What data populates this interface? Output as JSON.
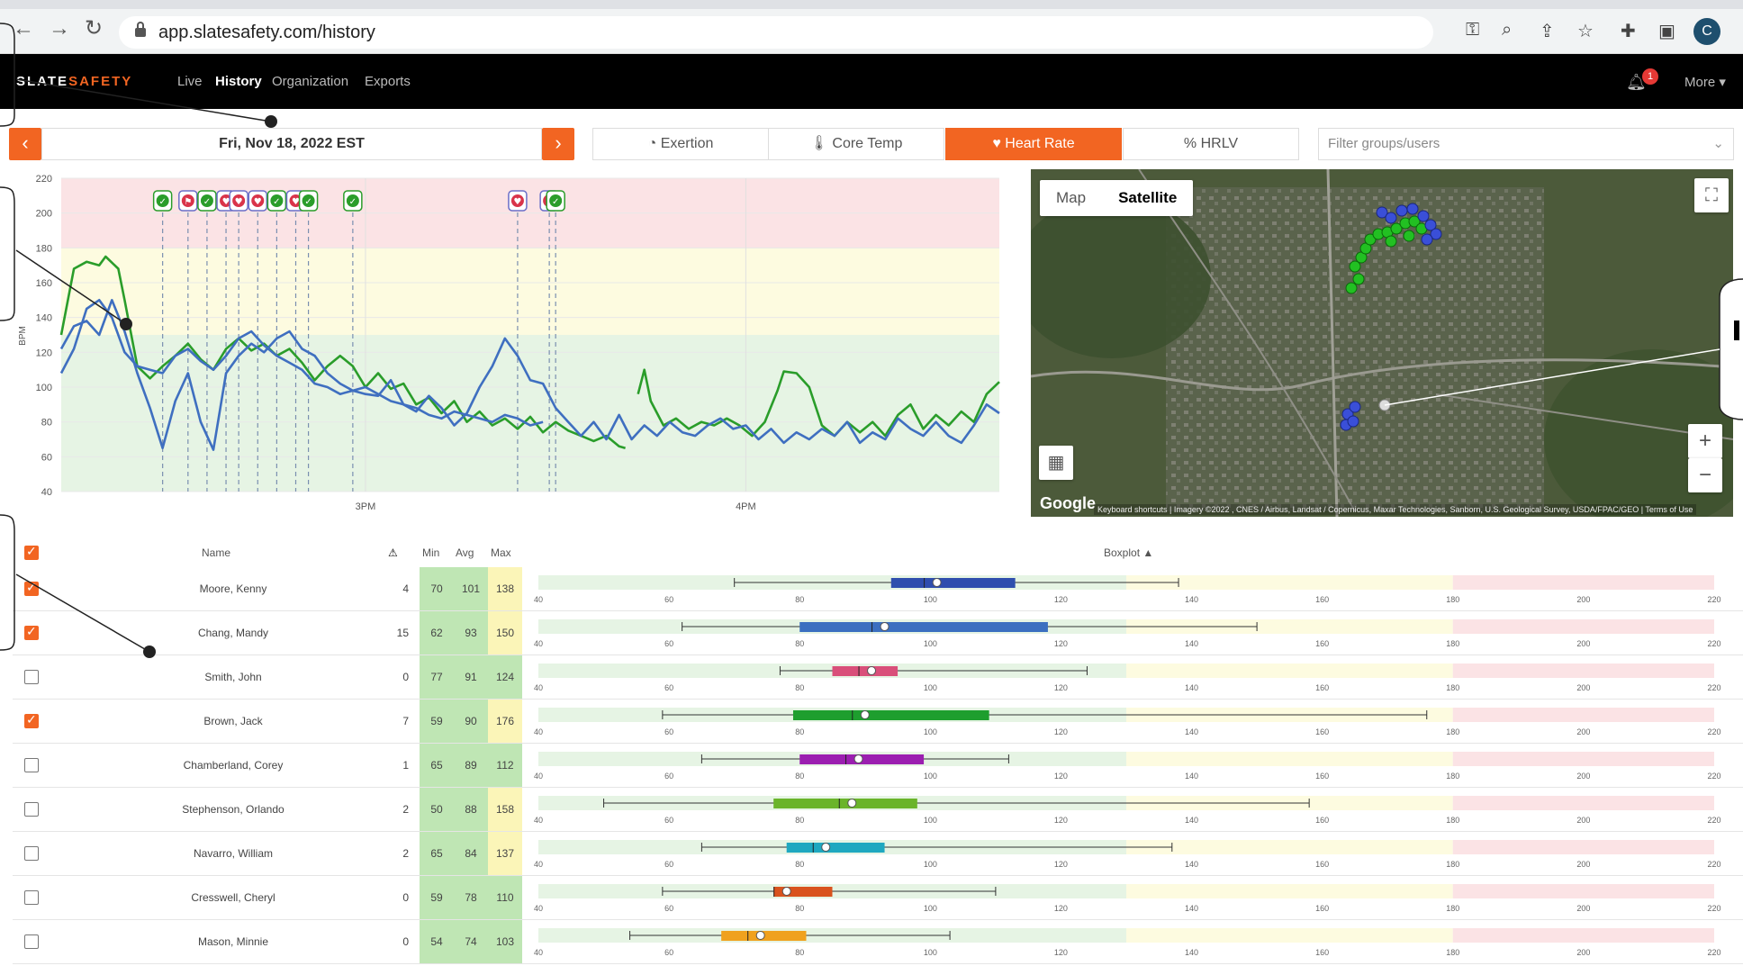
{
  "browser": {
    "url": "app.slatesafety.com/history",
    "profile_initial": "C"
  },
  "nav": {
    "logo_a": "SLATE",
    "logo_b": "SAFETY",
    "links": [
      "Live",
      "History",
      "Organization",
      "Exports"
    ],
    "notification_count": "1",
    "more_label": "More ▾"
  },
  "date_bar": {
    "date": "Fri, Nov 18, 2022 EST",
    "prev_symbol": "‹",
    "next_symbol": "›"
  },
  "metric_tabs": [
    {
      "icon": "gauge-icon",
      "label": "Exertion",
      "active": false
    },
    {
      "icon": "thermometer-icon",
      "label": "Core Temp",
      "active": false
    },
    {
      "icon": "heart-icon",
      "label": "Heart Rate",
      "active": true
    },
    {
      "icon": "percent-icon",
      "label": "HRLV",
      "active": false
    }
  ],
  "filter": {
    "placeholder": "Filter groups/users"
  },
  "map": {
    "tabs": [
      "Map",
      "Satellite"
    ],
    "selected_tab": "Satellite",
    "google": "Google",
    "attribution": "Keyboard shortcuts  |  Imagery ©2022 , CNES / Airbus, Landsat / Copernicus, Maxar Technologies, Sanborn, U.S. Geological Survey, USDA/FPAC/GEO  |  Terms of Use"
  },
  "chart_data": {
    "type": "line",
    "ylabel": "BPM",
    "ylim": [
      40,
      220
    ],
    "yticks": [
      40,
      60,
      80,
      100,
      120,
      140,
      160,
      180,
      200,
      220
    ],
    "xticks": [
      {
        "label": "3PM",
        "x": 900
      },
      {
        "label": "4PM",
        "x": 960
      }
    ],
    "xlim": [
      852,
      1000
    ],
    "zones": [
      {
        "from": 40,
        "to": 130,
        "color": "#e6f4e4"
      },
      {
        "from": 130,
        "to": 180,
        "color": "#fdfbe0"
      },
      {
        "from": 180,
        "to": 220,
        "color": "#fbe3e5"
      }
    ],
    "events": [
      {
        "x": 868,
        "type": "check"
      },
      {
        "x": 872,
        "type": "flag"
      },
      {
        "x": 875,
        "type": "check"
      },
      {
        "x": 878,
        "type": "heart"
      },
      {
        "x": 880,
        "type": "heart"
      },
      {
        "x": 883,
        "type": "heart"
      },
      {
        "x": 886,
        "type": "check"
      },
      {
        "x": 889,
        "type": "heart"
      },
      {
        "x": 891,
        "type": "check"
      },
      {
        "x": 898,
        "type": "check"
      },
      {
        "x": 924,
        "type": "heart"
      },
      {
        "x": 929,
        "type": "heart"
      },
      {
        "x": 930,
        "type": "check"
      }
    ],
    "series": [
      {
        "color": "#2a9d2a",
        "points": [
          [
            852,
            130
          ],
          [
            854,
            168
          ],
          [
            856,
            172
          ],
          [
            858,
            170
          ],
          [
            859,
            175
          ],
          [
            861,
            168
          ],
          [
            862,
            150
          ],
          [
            864,
            112
          ],
          [
            866,
            105
          ],
          [
            868,
            112
          ],
          [
            870,
            118
          ],
          [
            872,
            125
          ],
          [
            874,
            116
          ],
          [
            876,
            110
          ],
          [
            878,
            122
          ],
          [
            880,
            128
          ],
          [
            882,
            121
          ],
          [
            884,
            125
          ],
          [
            886,
            118
          ],
          [
            888,
            122
          ],
          [
            890,
            114
          ],
          [
            892,
            104
          ],
          [
            894,
            112
          ],
          [
            896,
            118
          ],
          [
            898,
            112
          ],
          [
            900,
            100
          ],
          [
            902,
            108
          ],
          [
            904,
            99
          ],
          [
            906,
            102
          ],
          [
            908,
            90
          ],
          [
            910,
            94
          ],
          [
            912,
            85
          ],
          [
            914,
            92
          ],
          [
            916,
            80
          ],
          [
            918,
            86
          ],
          [
            920,
            78
          ],
          [
            922,
            82
          ],
          [
            924,
            76
          ],
          [
            926,
            83
          ],
          [
            928,
            74
          ],
          [
            930,
            80
          ],
          [
            932,
            75
          ],
          [
            934,
            72
          ],
          [
            936,
            69
          ],
          [
            938,
            72
          ],
          [
            940,
            66
          ],
          [
            941,
            65
          ]
        ]
      },
      {
        "color": "#2a9d2a",
        "points": [
          [
            943,
            96
          ],
          [
            944,
            110
          ],
          [
            945,
            92
          ],
          [
            947,
            78
          ],
          [
            949,
            82
          ],
          [
            951,
            76
          ],
          [
            953,
            80
          ],
          [
            955,
            78
          ],
          [
            957,
            82
          ],
          [
            959,
            78
          ],
          [
            961,
            72
          ],
          [
            963,
            80
          ],
          [
            965,
            98
          ],
          [
            966,
            109
          ],
          [
            968,
            108
          ],
          [
            970,
            100
          ],
          [
            972,
            78
          ],
          [
            974,
            72
          ],
          [
            976,
            80
          ],
          [
            978,
            74
          ],
          [
            980,
            80
          ],
          [
            982,
            72
          ],
          [
            984,
            84
          ],
          [
            986,
            90
          ],
          [
            988,
            76
          ],
          [
            990,
            84
          ],
          [
            992,
            78
          ],
          [
            994,
            86
          ],
          [
            996,
            80
          ],
          [
            998,
            96
          ],
          [
            1000,
            103
          ]
        ]
      },
      {
        "color": "#3f6fc0",
        "points": [
          [
            852,
            122
          ],
          [
            854,
            135
          ],
          [
            856,
            138
          ],
          [
            858,
            130
          ],
          [
            860,
            150
          ],
          [
            862,
            132
          ],
          [
            864,
            108
          ],
          [
            866,
            88
          ],
          [
            868,
            65
          ],
          [
            870,
            92
          ],
          [
            872,
            108
          ],
          [
            874,
            80
          ],
          [
            876,
            64
          ],
          [
            878,
            108
          ],
          [
            880,
            118
          ],
          [
            882,
            125
          ],
          [
            884,
            120
          ],
          [
            886,
            128
          ],
          [
            888,
            132
          ],
          [
            890,
            122
          ],
          [
            892,
            118
          ],
          [
            894,
            108
          ],
          [
            896,
            102
          ],
          [
            898,
            98
          ],
          [
            900,
            96
          ],
          [
            902,
            95
          ],
          [
            904,
            104
          ],
          [
            906,
            90
          ],
          [
            908,
            86
          ],
          [
            910,
            95
          ],
          [
            912,
            88
          ],
          [
            914,
            78
          ],
          [
            916,
            85
          ],
          [
            918,
            100
          ],
          [
            920,
            112
          ],
          [
            922,
            128
          ],
          [
            924,
            118
          ],
          [
            926,
            104
          ],
          [
            928,
            102
          ],
          [
            930,
            88
          ],
          [
            932,
            80
          ],
          [
            934,
            72
          ],
          [
            936,
            80
          ],
          [
            938,
            70
          ],
          [
            940,
            84
          ],
          [
            942,
            70
          ],
          [
            944,
            78
          ],
          [
            946,
            72
          ],
          [
            948,
            80
          ],
          [
            950,
            74
          ],
          [
            952,
            72
          ],
          [
            954,
            78
          ],
          [
            956,
            82
          ],
          [
            958,
            76
          ],
          [
            960,
            78
          ],
          [
            962,
            70
          ],
          [
            964,
            76
          ],
          [
            966,
            68
          ],
          [
            968,
            74
          ],
          [
            970,
            70
          ],
          [
            972,
            76
          ],
          [
            974,
            72
          ],
          [
            976,
            80
          ],
          [
            978,
            68
          ],
          [
            980,
            74
          ],
          [
            982,
            70
          ],
          [
            984,
            82
          ],
          [
            986,
            76
          ],
          [
            988,
            72
          ],
          [
            990,
            80
          ],
          [
            992,
            72
          ],
          [
            994,
            68
          ],
          [
            996,
            78
          ],
          [
            998,
            90
          ],
          [
            1000,
            85
          ]
        ]
      },
      {
        "color": "#3f6fc0",
        "points": [
          [
            852,
            108
          ],
          [
            854,
            122
          ],
          [
            856,
            145
          ],
          [
            858,
            150
          ],
          [
            860,
            140
          ],
          [
            862,
            120
          ],
          [
            864,
            112
          ],
          [
            866,
            110
          ],
          [
            868,
            108
          ],
          [
            870,
            118
          ],
          [
            872,
            122
          ],
          [
            874,
            115
          ],
          [
            876,
            110
          ],
          [
            878,
            118
          ],
          [
            880,
            128
          ],
          [
            882,
            132
          ],
          [
            884,
            124
          ],
          [
            886,
            118
          ],
          [
            888,
            114
          ],
          [
            890,
            110
          ],
          [
            892,
            102
          ],
          [
            894,
            100
          ],
          [
            896,
            96
          ],
          [
            898,
            98
          ],
          [
            900,
            100
          ],
          [
            902,
            96
          ],
          [
            904,
            92
          ],
          [
            906,
            90
          ],
          [
            908,
            88
          ],
          [
            910,
            84
          ],
          [
            912,
            82
          ],
          [
            914,
            86
          ],
          [
            916,
            84
          ],
          [
            918,
            82
          ],
          [
            920,
            80
          ],
          [
            922,
            84
          ],
          [
            924,
            82
          ],
          [
            926,
            78
          ],
          [
            928,
            80
          ]
        ]
      }
    ]
  },
  "table": {
    "headers": {
      "name": "Name",
      "alerts": "⚠",
      "min": "Min",
      "avg": "Avg",
      "max": "Max",
      "boxplot": "Boxplot ▲"
    },
    "axis_ticks": [
      40,
      60,
      80,
      100,
      120,
      140,
      160,
      180,
      200,
      220
    ],
    "rows": [
      {
        "checked": true,
        "name": "Moore, Kenny",
        "alerts": "4",
        "min": "70",
        "avg": "101",
        "max": "138",
        "color": "#2f4fae",
        "box": [
          70,
          94,
          101,
          113,
          138
        ]
      },
      {
        "checked": true,
        "name": "Chang, Mandy",
        "alerts": "15",
        "min": "62",
        "avg": "93",
        "max": "150",
        "color": "#3b6fc0",
        "box": [
          62,
          80,
          93,
          118,
          150
        ]
      },
      {
        "checked": false,
        "name": "Smith, John",
        "alerts": "0",
        "min": "77",
        "avg": "91",
        "max": "124",
        "color": "#d94f7a",
        "box": [
          77,
          85,
          91,
          95,
          124
        ]
      },
      {
        "checked": true,
        "name": "Brown, Jack",
        "alerts": "7",
        "min": "59",
        "avg": "90",
        "max": "176",
        "color": "#1e9e2e",
        "box": [
          59,
          79,
          90,
          109,
          176
        ]
      },
      {
        "checked": false,
        "name": "Chamberland, Corey",
        "alerts": "1",
        "min": "65",
        "avg": "89",
        "max": "112",
        "color": "#9b1fb0",
        "box": [
          65,
          80,
          89,
          99,
          112
        ]
      },
      {
        "checked": false,
        "name": "Stephenson, Orlando",
        "alerts": "2",
        "min": "50",
        "avg": "88",
        "max": "158",
        "color": "#6ab42a",
        "box": [
          50,
          76,
          88,
          98,
          158
        ]
      },
      {
        "checked": false,
        "name": "Navarro, William",
        "alerts": "2",
        "min": "65",
        "avg": "84",
        "max": "137",
        "color": "#1fa8c0",
        "box": [
          65,
          78,
          84,
          93,
          137
        ]
      },
      {
        "checked": false,
        "name": "Cresswell, Cheryl",
        "alerts": "0",
        "min": "59",
        "avg": "78",
        "max": "110",
        "color": "#d9531e",
        "box": [
          59,
          76,
          78,
          85,
          110
        ]
      },
      {
        "checked": false,
        "name": "Mason, Minnie",
        "alerts": "0",
        "min": "54",
        "avg": "74",
        "max": "103",
        "color": "#f0a11e",
        "box": [
          54,
          68,
          74,
          81,
          103
        ]
      }
    ]
  },
  "colors": {
    "accent": "#f26522",
    "zone_green": "#bfe6b4",
    "zone_yellow": "#fbf5b8"
  }
}
